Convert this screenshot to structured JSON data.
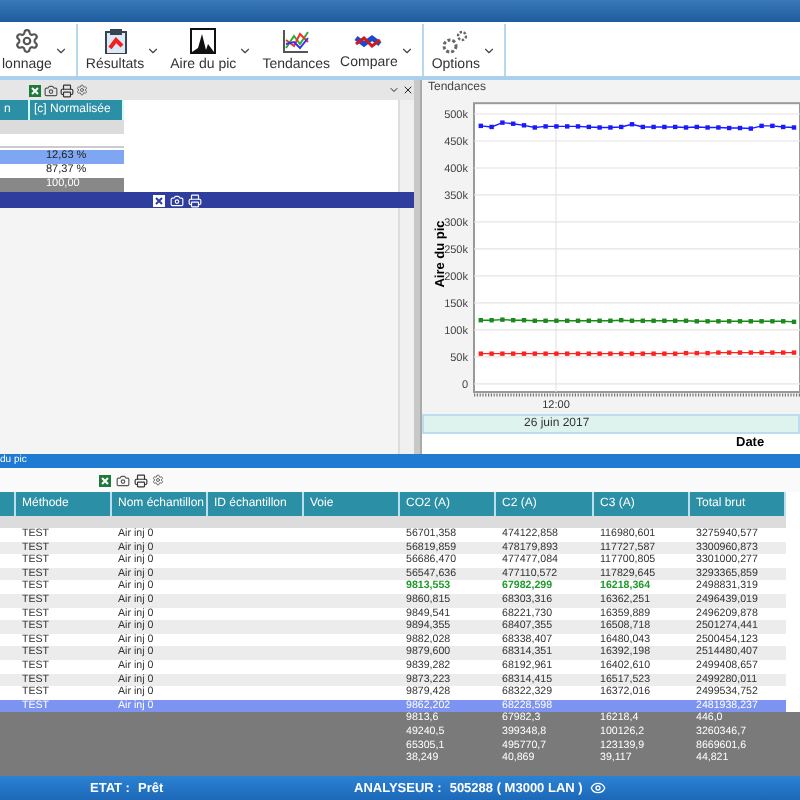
{
  "ribbon": {
    "sections": [
      {
        "buttons": [
          {
            "label": "lonnage",
            "kind": "gear",
            "dropdown": true
          }
        ]
      },
      {
        "buttons": [
          {
            "label": "Résultats",
            "kind": "clipboard",
            "dropdown": true
          },
          {
            "label": "Aire du pic",
            "kind": "peak",
            "dropdown": true
          },
          {
            "label": "Tendances",
            "kind": "trend",
            "dropdown": false
          },
          {
            "label": "Compare",
            "kind": "compare",
            "dropdown": true
          }
        ]
      },
      {
        "buttons": [
          {
            "label": "Options",
            "kind": "gears",
            "dropdown": true
          }
        ]
      }
    ]
  },
  "left_table": {
    "columns": [
      "n",
      "[c] Normalisée"
    ],
    "rows": [
      {
        "value": "12,63 %",
        "selected": true,
        "kind": "value"
      },
      {
        "value": "87,37 %",
        "selected": false,
        "kind": "value"
      },
      {
        "value": "100,00",
        "selected": false,
        "kind": "total"
      }
    ]
  },
  "trends": {
    "title": "Tendances",
    "time_tick": "12:00",
    "date_band": "26 juin 2017",
    "chart_data": {
      "type": "line",
      "xlabel": "Date",
      "ylabel": "Aire du pic",
      "grid": true,
      "ylim": [
        -15000,
        520000
      ],
      "yticks": [
        {
          "value": 0,
          "label": "0"
        },
        {
          "value": 50000,
          "label": "50k"
        },
        {
          "value": 100000,
          "label": "100k"
        },
        {
          "value": 150000,
          "label": "150k"
        },
        {
          "value": 200000,
          "label": "200k"
        },
        {
          "value": 250000,
          "label": "250k"
        },
        {
          "value": 300000,
          "label": "300k"
        },
        {
          "value": 350000,
          "label": "350k"
        },
        {
          "value": 400000,
          "label": "400k"
        },
        {
          "value": 450000,
          "label": "450k"
        },
        {
          "value": 500000,
          "label": "500k"
        }
      ],
      "series": [
        {
          "color": "#1a1aff",
          "marker": "square",
          "values": [
            478000,
            476000,
            484000,
            482000,
            479000,
            475000,
            477000,
            477000,
            477000,
            477000,
            476000,
            475000,
            475000,
            476000,
            481000,
            476000,
            476000,
            476000,
            476000,
            475000,
            476000,
            475000,
            475000,
            474000,
            474000,
            473000,
            478000,
            478000,
            476000,
            475000
          ]
        },
        {
          "color": "#1a8a1a",
          "marker": "square",
          "values": [
            118000,
            118000,
            119000,
            118000,
            118000,
            117000,
            117000,
            117000,
            117000,
            117000,
            117000,
            117000,
            117000,
            118000,
            117000,
            117000,
            117000,
            117000,
            117000,
            117000,
            116000,
            116000,
            116000,
            116000,
            116000,
            116000,
            116000,
            116000,
            116000,
            115000
          ]
        },
        {
          "color": "#ff2020",
          "marker": "square",
          "values": [
            56000,
            56000,
            56000,
            56000,
            56000,
            56000,
            56000,
            56000,
            56000,
            56000,
            56000,
            56000,
            56000,
            56000,
            56000,
            56000,
            56000,
            56000,
            56000,
            57000,
            57000,
            57000,
            58000,
            58000,
            58000,
            58000,
            58000,
            58000,
            58000,
            58000
          ]
        }
      ]
    }
  },
  "results": {
    "title": "du pic",
    "columns": [
      "Méthode",
      "Nom échantillon",
      "ID échantillon",
      "Voie",
      "CO2 (A)",
      "C2 (A)",
      "C3 (A)",
      "Total brut"
    ],
    "rows": [
      {
        "method": "TEST",
        "sample": "Air inj 0",
        "co2": "56701,358",
        "c2": "474122,858",
        "c3": "116980,601",
        "total": "3275940,577",
        "selected": false,
        "kind": "normal"
      },
      {
        "method": "TEST",
        "sample": "Air inj 0",
        "co2": "56819,859",
        "c2": "478179,893",
        "c3": "117727,587",
        "total": "3300960,873",
        "selected": false,
        "kind": "normal"
      },
      {
        "method": "TEST",
        "sample": "Air inj 0",
        "co2": "56686,470",
        "c2": "477477,084",
        "c3": "117700,805",
        "total": "3301000,277",
        "selected": false,
        "kind": "normal"
      },
      {
        "method": "TEST",
        "sample": "Air inj 0",
        "co2": "56547,636",
        "c2": "477110,572",
        "c3": "117829,645",
        "total": "3293365,859",
        "selected": false,
        "kind": "normal"
      },
      {
        "method": "TEST",
        "sample": "Air inj 0",
        "co2": "9813,553",
        "c2": "67982,299",
        "c3": "16218,364",
        "total": "2498831,319",
        "selected": false,
        "kind": "reference"
      },
      {
        "method": "TEST",
        "sample": "Air inj 0",
        "co2": "9860,815",
        "c2": "68303,316",
        "c3": "16362,251",
        "total": "2496439,019",
        "selected": false,
        "kind": "normal"
      },
      {
        "method": "TEST",
        "sample": "Air inj 0",
        "co2": "9849,541",
        "c2": "68221,730",
        "c3": "16359,889",
        "total": "2496209,878",
        "selected": false,
        "kind": "normal"
      },
      {
        "method": "TEST",
        "sample": "Air inj 0",
        "co2": "9894,355",
        "c2": "68407,355",
        "c3": "16508,718",
        "total": "2501274,441",
        "selected": false,
        "kind": "normal"
      },
      {
        "method": "TEST",
        "sample": "Air inj 0",
        "co2": "9882,028",
        "c2": "68338,407",
        "c3": "16480,043",
        "total": "2500454,123",
        "selected": false,
        "kind": "normal"
      },
      {
        "method": "TEST",
        "sample": "Air inj 0",
        "co2": "9879,600",
        "c2": "68314,351",
        "c3": "16392,198",
        "total": "2514480,407",
        "selected": false,
        "kind": "normal"
      },
      {
        "method": "TEST",
        "sample": "Air inj 0",
        "co2": "9839,282",
        "c2": "68192,961",
        "c3": "16402,610",
        "total": "2499408,657",
        "selected": false,
        "kind": "normal"
      },
      {
        "method": "TEST",
        "sample": "Air inj 0",
        "co2": "9873,223",
        "c2": "68314,415",
        "c3": "16517,523",
        "total": "2499280,011",
        "selected": false,
        "kind": "normal"
      },
      {
        "method": "TEST",
        "sample": "Air inj 0",
        "co2": "9879,428",
        "c2": "68322,329",
        "c3": "16372,016",
        "total": "2499534,752",
        "selected": false,
        "kind": "normal"
      },
      {
        "method": "TEST",
        "sample": "Air inj 0",
        "co2": "9862,202",
        "c2": "68228,598",
        "total": "2481938,237",
        "selected": true,
        "kind": "normal"
      }
    ],
    "summary": [
      [
        "9813,6",
        "67982,3",
        "16218,4",
        "446,0"
      ],
      [
        "49240,5",
        "399348,8",
        "100126,2",
        "3260346,7"
      ],
      [
        "65305,1",
        "495770,7",
        "123139,9",
        "8669601,6"
      ],
      [
        "38,249",
        "40,869",
        "39,117",
        "44,821"
      ]
    ]
  },
  "status_bar": {
    "state_label": "ETAT :",
    "state": "Prêt",
    "analyzer_label": "ANALYSEUR :",
    "analyzer": "505288 ( M3000 LAN )"
  }
}
